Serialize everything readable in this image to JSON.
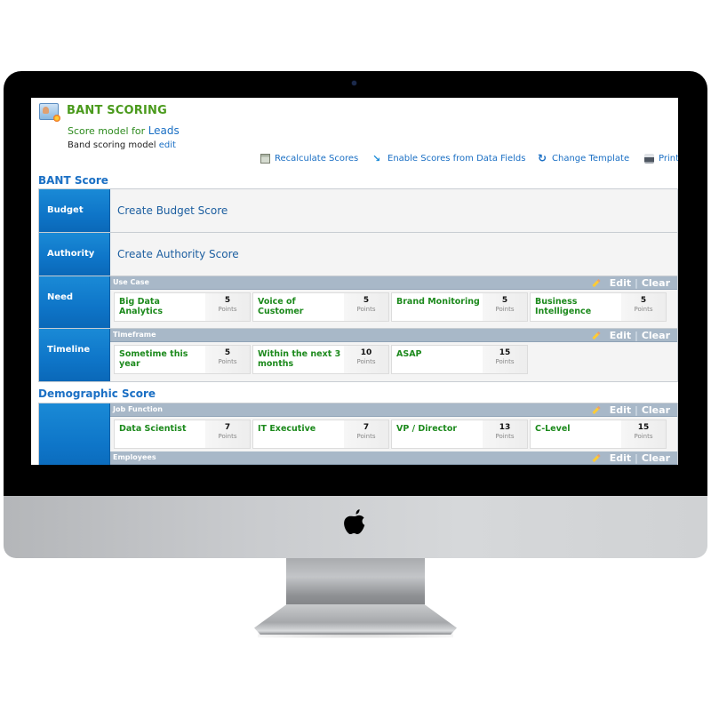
{
  "app": {
    "title": "BANT SCORING",
    "model_prefix": "Score model for",
    "model_entity": "Leads",
    "band_prefix": "Band scoring model",
    "band_edit": "edit"
  },
  "toolbar": [
    {
      "label": "Recalculate Scores",
      "icon": "calculator-icon"
    },
    {
      "label": "Enable Scores from Data Fields",
      "icon": "import-arrow-icon"
    },
    {
      "label": "Change Template",
      "icon": "refresh-icon"
    },
    {
      "label": "Print",
      "icon": "printer-icon"
    }
  ],
  "bant": {
    "title": "BANT Score",
    "budget": {
      "label": "Budget",
      "action": "Create Budget Score"
    },
    "authority": {
      "label": "Authority",
      "action": "Create Authority Score"
    },
    "need": {
      "label": "Need",
      "group": "Use Case",
      "items": [
        {
          "name": "Big Data Analytics",
          "points": "5"
        },
        {
          "name": "Voice of Customer",
          "points": "5"
        },
        {
          "name": "Brand Monitoring",
          "points": "5"
        },
        {
          "name": "Business Intelligence",
          "points": "5"
        }
      ]
    },
    "timeline": {
      "label": "Timeline",
      "group": "Timeframe",
      "items": [
        {
          "name": "Sometime this year",
          "points": "5"
        },
        {
          "name": "Within the next 3 months",
          "points": "10"
        },
        {
          "name": "ASAP",
          "points": "15"
        }
      ]
    }
  },
  "demographic": {
    "title": "Demographic Score",
    "job_function": {
      "group": "Job Function",
      "items": [
        {
          "name": "Data Scientist",
          "points": "7"
        },
        {
          "name": "IT Executive",
          "points": "7"
        },
        {
          "name": "VP / Director",
          "points": "13"
        },
        {
          "name": "C-Level",
          "points": "15"
        }
      ]
    },
    "employees": {
      "group": "Employees"
    }
  },
  "common": {
    "points_unit": "Points",
    "edit": "Edit",
    "separator": "|",
    "clear": "Clear"
  },
  "colors": {
    "accent_blue": "#1a6fc4",
    "title_green": "#4a9a1c",
    "item_green": "#1d8a1d",
    "label_blue": "#0e75c8",
    "group_header": "#a8b8c8"
  }
}
